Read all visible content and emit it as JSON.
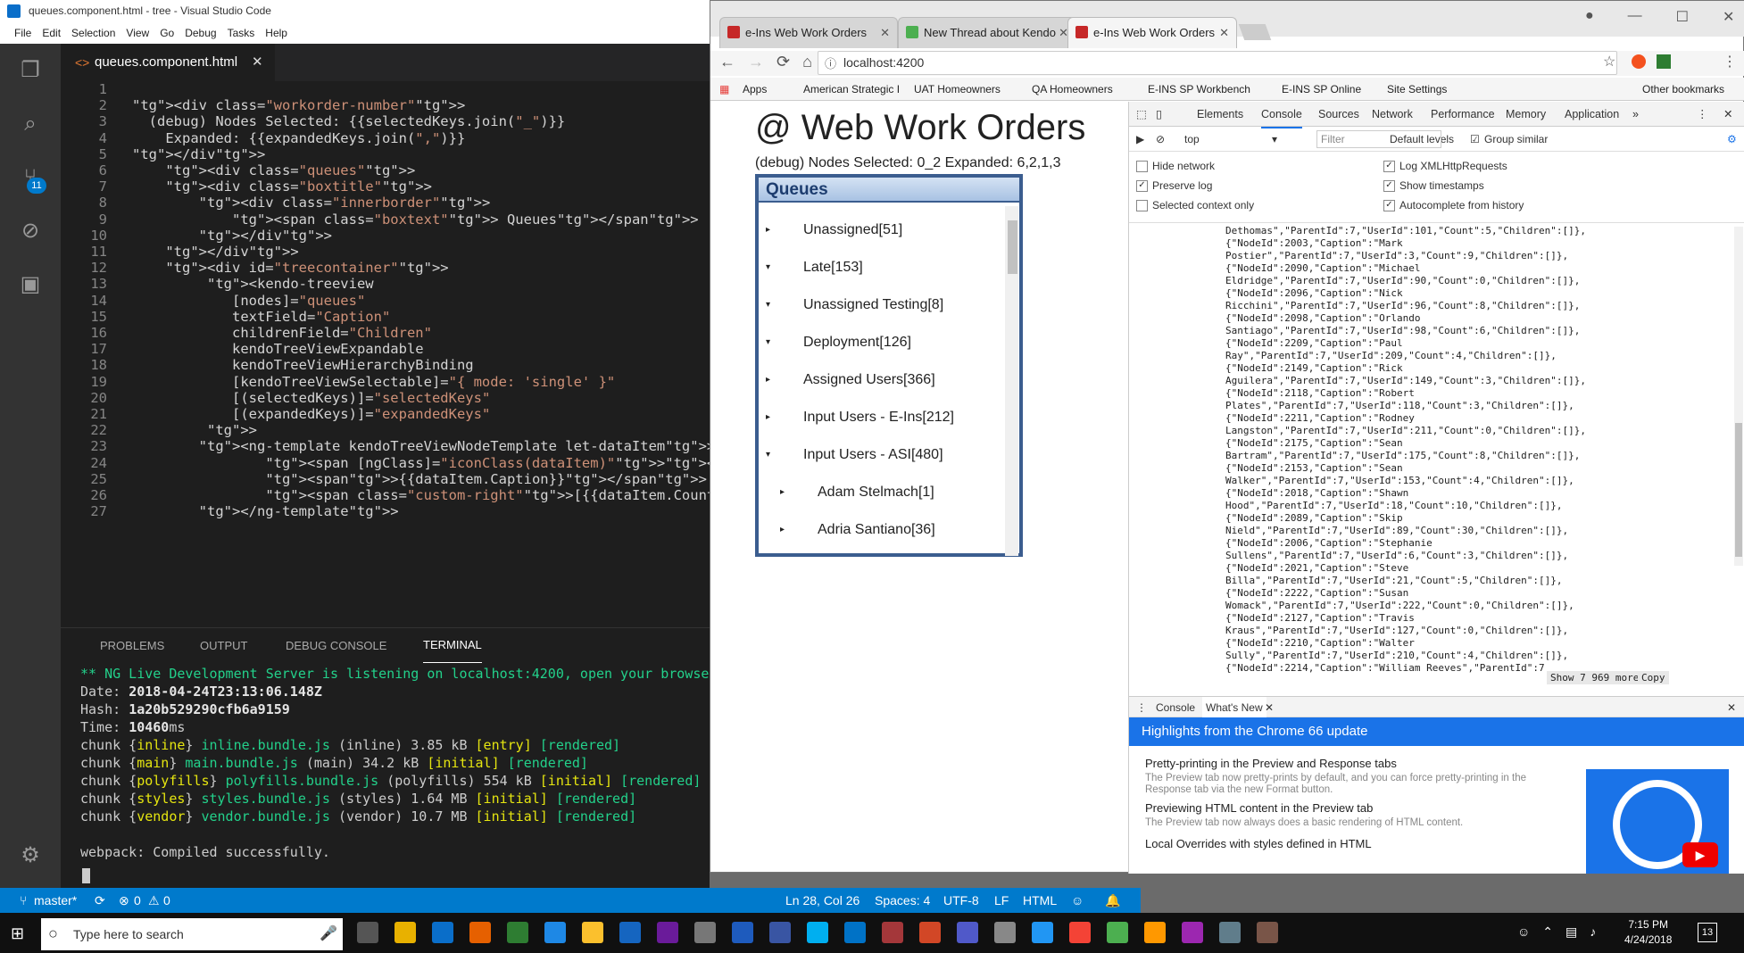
{
  "vscode": {
    "title": "queues.component.html - tree - Visual Studio Code",
    "menu": [
      "File",
      "Edit",
      "Selection",
      "View",
      "Go",
      "Debug",
      "Tasks",
      "Help"
    ],
    "tab": "queues.component.html",
    "scm_badge": "11",
    "lines": [
      "1",
      "2",
      "3",
      "4",
      "5",
      "6",
      "7",
      "8",
      "9",
      "10",
      "11",
      "12",
      "13",
      "14",
      "15",
      "16",
      "17",
      "18",
      "19",
      "20",
      "21",
      "22",
      "23",
      "24",
      "25",
      "26",
      "27"
    ],
    "code": [
      "",
      "<div class=\"workorder-number\">",
      "  (debug) Nodes Selected: {{selectedKeys.join(\"_\")}}",
      "    Expanded: {{expandedKeys.join(\",\")}}",
      "</div>",
      "    <div class=\"queues\">",
      "    <div class=\"boxtitle\">",
      "        <div class=\"innerborder\">",
      "            <span class=\"boxtext\"> Queues</span>",
      "        </div>",
      "    </div>",
      "    <div id=\"treecontainer\">",
      "         <kendo-treeview",
      "            [nodes]=\"queues\"",
      "            textField=\"Caption\"",
      "            childrenField=\"Children\"",
      "            kendoTreeViewExpandable",
      "            kendoTreeViewHierarchyBinding",
      "            [kendoTreeViewSelectable]=\"{ mode: 'single' }\"",
      "            [(selectedKeys)]=\"selectedKeys\"",
      "            [(expandedKeys)]=\"expandedKeys\"",
      "         >",
      "        <ng-template kendoTreeViewNodeTemplate let-dataItem>",
      "                <span [ngClass]=\"iconClass(dataItem)\"></span>",
      "                <span>{{dataItem.Caption}}</span>",
      "                <span class=\"custom-right\">[{{dataItem.Count}}]</span>",
      "        </ng-template>"
    ],
    "panel_tabs": [
      "PROBLEMS",
      "OUTPUT",
      "DEBUG CONSOLE",
      "TERMINAL"
    ],
    "terminal": {
      "line1": "** NG Live Development Server is listening on localhost:4200, open your browse",
      "date_label": "Date: ",
      "date": "2018-04-24T23:13:06.148Z",
      "hash_label": "Hash: ",
      "hash": "1a20b529290cfb6a9159",
      "time_label": "Time: ",
      "time": "10460",
      "time_unit": "ms",
      "chunks": [
        {
          "name": "inline",
          "file": "inline.bundle.js",
          "type": "(inline)",
          "size": "3.85 kB",
          "tag": "[entry]",
          "state": "[rendered]"
        },
        {
          "name": "main",
          "file": "main.bundle.js",
          "type": "(main)",
          "size": "34.2 kB",
          "tag": "[initial]",
          "state": "[rendered]"
        },
        {
          "name": "polyfills",
          "file": "polyfills.bundle.js",
          "type": "(polyfills)",
          "size": "554 kB",
          "tag": "[initial]",
          "state": "[rendered]"
        },
        {
          "name": "styles",
          "file": "styles.bundle.js",
          "type": "(styles)",
          "size": "1.64 MB",
          "tag": "[initial]",
          "state": "[rendered]"
        },
        {
          "name": "vendor",
          "file": "vendor.bundle.js",
          "type": "(vendor)",
          "size": "10.7 MB",
          "tag": "[initial]",
          "state": "[rendered]"
        }
      ],
      "done": "webpack: Compiled successfully."
    },
    "status": {
      "branch": "master*",
      "errors": "0",
      "warnings": "0",
      "pos": "Ln 28, Col 26",
      "spaces": "Spaces: 4",
      "enc": "UTF-8",
      "eol": "LF",
      "lang": "HTML"
    }
  },
  "chrome": {
    "tabs": [
      "e-Ins Web Work Orders",
      "New Thread about Kendo",
      "e-Ins Web Work Orders"
    ],
    "url": "localhost:4200",
    "bookmarks": [
      "Apps",
      "American Strategic I",
      "UAT Homeowners",
      "QA Homeowners",
      "E-INS SP Workbench",
      "E-INS SP Online",
      "Site Settings",
      "Other bookmarks"
    ],
    "page": {
      "title": "@ Web Work Orders",
      "debug": "(debug) Nodes Selected: 0_2 Expanded: 6,2,1,3",
      "queues_title": "Queues",
      "items": [
        "Unassigned[51]",
        "Late[153]",
        "Unassigned Testing[8]",
        "Deployment[126]",
        "Assigned Users[366]",
        "Input Users - E-Ins[212]",
        "Input Users - ASI[480]",
        "Adam Stelmach[1]",
        "Adria Santiano[36]"
      ]
    },
    "devtools": {
      "tabs": [
        "Elements",
        "Console",
        "Sources",
        "Network",
        "Performance",
        "Memory",
        "Application"
      ],
      "context": "top",
      "filter_placeholder": "Filter",
      "levels": "Default levels",
      "group": "Group similar",
      "settings": [
        "Hide network",
        "Preserve log",
        "Selected context only",
        "Log XMLHttpRequests",
        "Show timestamps",
        "Autocomplete from history"
      ],
      "log": [
        "Dethomas\",\"ParentId\":7,\"UserId\":101,\"Count\":5,\"Children\":[]},",
        "{\"NodeId\":2003,\"Caption\":\"Mark",
        "Postier\",\"ParentId\":7,\"UserId\":3,\"Count\":9,\"Children\":[]},",
        "{\"NodeId\":2090,\"Caption\":\"Michael",
        "Eldridge\",\"ParentId\":7,\"UserId\":90,\"Count\":0,\"Children\":[]},",
        "{\"NodeId\":2096,\"Caption\":\"Nick",
        "Ricchini\",\"ParentId\":7,\"UserId\":96,\"Count\":8,\"Children\":[]},",
        "{\"NodeId\":2098,\"Caption\":\"Orlando",
        "Santiago\",\"ParentId\":7,\"UserId\":98,\"Count\":6,\"Children\":[]},",
        "{\"NodeId\":2209,\"Caption\":\"Paul",
        "Ray\",\"ParentId\":7,\"UserId\":209,\"Count\":4,\"Children\":[]},",
        "{\"NodeId\":2149,\"Caption\":\"Rick",
        "Aguilera\",\"ParentId\":7,\"UserId\":149,\"Count\":3,\"Children\":[]},",
        "{\"NodeId\":2118,\"Caption\":\"Robert",
        "Plates\",\"ParentId\":7,\"UserId\":118,\"Count\":3,\"Children\":[]},",
        "{\"NodeId\":2211,\"Caption\":\"Rodney",
        "Langston\",\"ParentId\":7,\"UserId\":211,\"Count\":0,\"Children\":[]},",
        "{\"NodeId\":2175,\"Caption\":\"Sean",
        "Bartram\",\"ParentId\":7,\"UserId\":175,\"Count\":8,\"Children\":[]},",
        "{\"NodeId\":2153,\"Caption\":\"Sean",
        "Walker\",\"ParentId\":7,\"UserId\":153,\"Count\":4,\"Children\":[]},",
        "{\"NodeId\":2018,\"Caption\":\"Shawn",
        "Hood\",\"ParentId\":7,\"UserId\":18,\"Count\":10,\"Children\":[]},",
        "{\"NodeId\":2089,\"Caption\":\"Skip",
        "Nield\",\"ParentId\":7,\"UserId\":89,\"Count\":30,\"Children\":[]},",
        "{\"NodeId\":2006,\"Caption\":\"Stephanie",
        "Sullens\",\"ParentId\":7,\"UserId\":6,\"Count\":3,\"Children\":[]},",
        "{\"NodeId\":2021,\"Caption\":\"Steve",
        "Billa\",\"ParentId\":7,\"UserId\":21,\"Count\":5,\"Children\":[]},",
        "{\"NodeId\":2222,\"Caption\":\"Susan",
        "Womack\",\"ParentId\":7,\"UserId\":222,\"Count\":0,\"Children\":[]},",
        "{\"NodeId\":2127,\"Caption\":\"Travis",
        "Kraus\",\"ParentId\":7,\"UserId\":127,\"Count\":0,\"Children\":[]},",
        "{\"NodeId\":2210,\"Caption\":\"Walter",
        "Sully\",\"ParentId\":7,\"UserId\":210,\"Count\":4,\"Children\":[]},",
        "{\"NodeId\":2214,\"Caption\":\"William Reeves\",\"ParentId\":7"
      ],
      "show_more": "Show 7 969 more",
      "copy": "Copy",
      "drawer_tabs": [
        "Console",
        "What's New"
      ],
      "highlights": "Highlights from the Chrome 66 update",
      "news": [
        {
          "t": "Pretty-printing in the Preview and Response tabs",
          "d": "The Preview tab now pretty-prints by default, and you can force pretty-printing in the Response tab via the new Format button."
        },
        {
          "t": "Previewing HTML content in the Preview tab",
          "d": "The Preview tab now always does a basic rendering of HTML content."
        },
        {
          "t": "Local Overrides with styles defined in HTML",
          "d": ""
        }
      ]
    }
  },
  "taskbar": {
    "search_placeholder": "Type here to search",
    "time": "7:15 PM",
    "date": "4/24/2018",
    "notif": "13"
  }
}
